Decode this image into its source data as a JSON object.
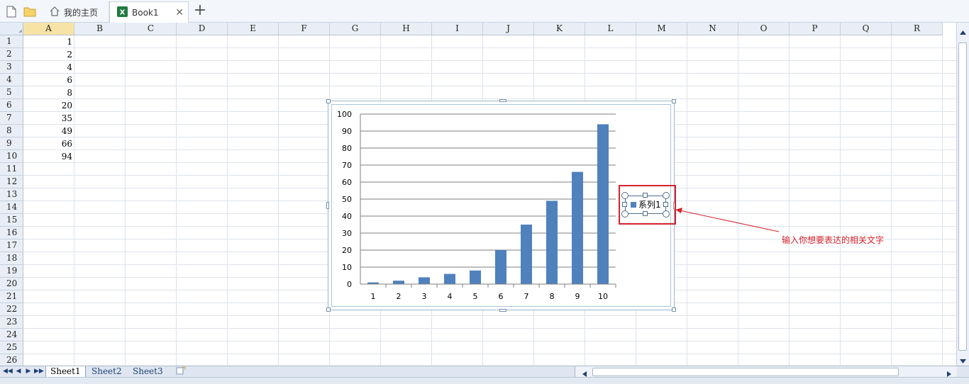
{
  "tabs": {
    "home_label": "我的主页",
    "book_label": "Book1"
  },
  "columns": [
    "A",
    "B",
    "C",
    "D",
    "E",
    "F",
    "G",
    "H",
    "I",
    "J",
    "K",
    "L",
    "M",
    "N",
    "O",
    "P",
    "Q",
    "R"
  ],
  "rows": [
    "1",
    "2",
    "3",
    "4",
    "5",
    "6",
    "7",
    "8",
    "9",
    "10",
    "11",
    "12",
    "13",
    "14",
    "15",
    "16",
    "17",
    "18",
    "19",
    "20",
    "21",
    "22",
    "23",
    "24",
    "25",
    "26"
  ],
  "cells_A": [
    "1",
    "2",
    "4",
    "6",
    "8",
    "20",
    "35",
    "49",
    "66",
    "94"
  ],
  "chart_data": {
    "type": "bar",
    "categories": [
      "1",
      "2",
      "3",
      "4",
      "5",
      "6",
      "7",
      "8",
      "9",
      "10"
    ],
    "series": [
      {
        "name": "系列1",
        "values": [
          1,
          2,
          4,
          6,
          8,
          20,
          35,
          49,
          66,
          94
        ],
        "color": "#4f81bd"
      }
    ],
    "yticks": [
      "0",
      "10",
      "20",
      "30",
      "40",
      "50",
      "60",
      "70",
      "80",
      "90",
      "100"
    ],
    "ylim": [
      0,
      100
    ],
    "grid": true,
    "legend": "right"
  },
  "legend_label": "系列1",
  "annotation": "输入你想要表达的相关文字",
  "sheets": [
    "Sheet1",
    "Sheet2",
    "Sheet3"
  ],
  "colors": {
    "accent": "#d6222c",
    "bar": "#4f81bd"
  }
}
